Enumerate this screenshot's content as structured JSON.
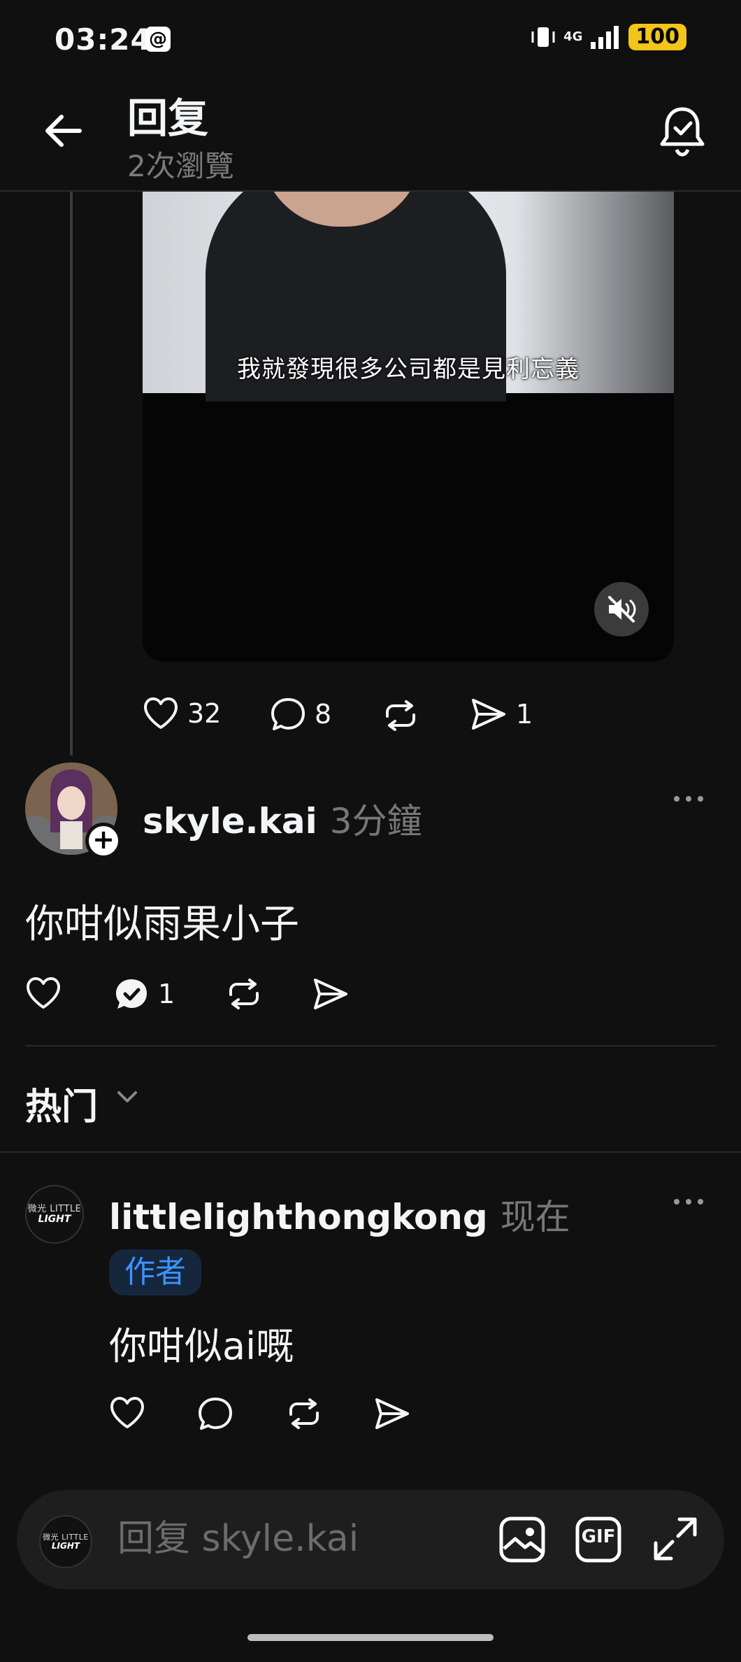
{
  "status_bar": {
    "time": "03:24",
    "app_badge": "@",
    "network": "4G",
    "battery": "100"
  },
  "header": {
    "title": "回复",
    "subtitle": "2次瀏覽"
  },
  "video": {
    "caption": "我就發現很多公司都是見利忘義"
  },
  "post_actions": {
    "likes": "32",
    "comments": "8",
    "shares": "1"
  },
  "comment": {
    "username": "skyle.kai",
    "time": "3分鐘",
    "text": "你咁似雨果小子",
    "reply_count": "1"
  },
  "sort": {
    "label": "热门"
  },
  "reply": {
    "username": "littlelighthongkong",
    "time": "现在",
    "tag": "作者",
    "text": "你咁似ai嘅",
    "logo_small": "微光 LITTLE",
    "logo_big": "LIGHT"
  },
  "composer": {
    "placeholder": "回复 skyle.kai",
    "gif_label": "GIF"
  },
  "icons": {
    "back": "arrow-left-icon",
    "notify": "bell-check-icon",
    "mute": "speaker-muted-icon",
    "like": "heart-icon",
    "comment": "chat-bubble-icon",
    "repost": "repost-icon",
    "share": "send-icon",
    "more": "more-horizontal-icon",
    "image": "image-icon",
    "gif": "gif-icon",
    "expand": "expand-icon"
  },
  "colors": {
    "background": "#101010",
    "accent_blue": "#3b93ff",
    "battery": "#f2c518"
  }
}
